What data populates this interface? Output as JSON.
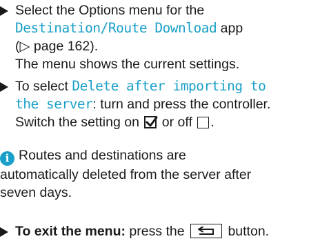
{
  "steps": [
    {
      "line1": "Select the Options menu for the",
      "app_name": "Destination/Route Download",
      "app_suffix": " app",
      "page_ref": "(▷ page 162).",
      "result": "The menu shows the current settings."
    },
    {
      "prefix": "To select ",
      "option_part1": "Delete after importing to",
      "option_part2": "the server",
      "instruction": ": turn and press the controller.",
      "switch_prefix": "Switch the setting on ",
      "switch_middle": " or off ",
      "switch_end": "."
    },
    {
      "bold_label": "To exit the menu:",
      "text_before": " press the ",
      "text_after": " button."
    }
  ],
  "note": {
    "icon_letter": "i",
    "line1": "Routes and destinations are",
    "line2": "automatically deleted from the server after",
    "line3": "seven days."
  },
  "colors": {
    "accent": "#19a0c8",
    "text": "#1a1a1a"
  },
  "icons": {
    "bullet": "triangle-bullet-icon",
    "checked": "checkbox-checked-icon",
    "unchecked": "checkbox-empty-icon",
    "info": "info-icon",
    "back": "back-button-icon"
  }
}
